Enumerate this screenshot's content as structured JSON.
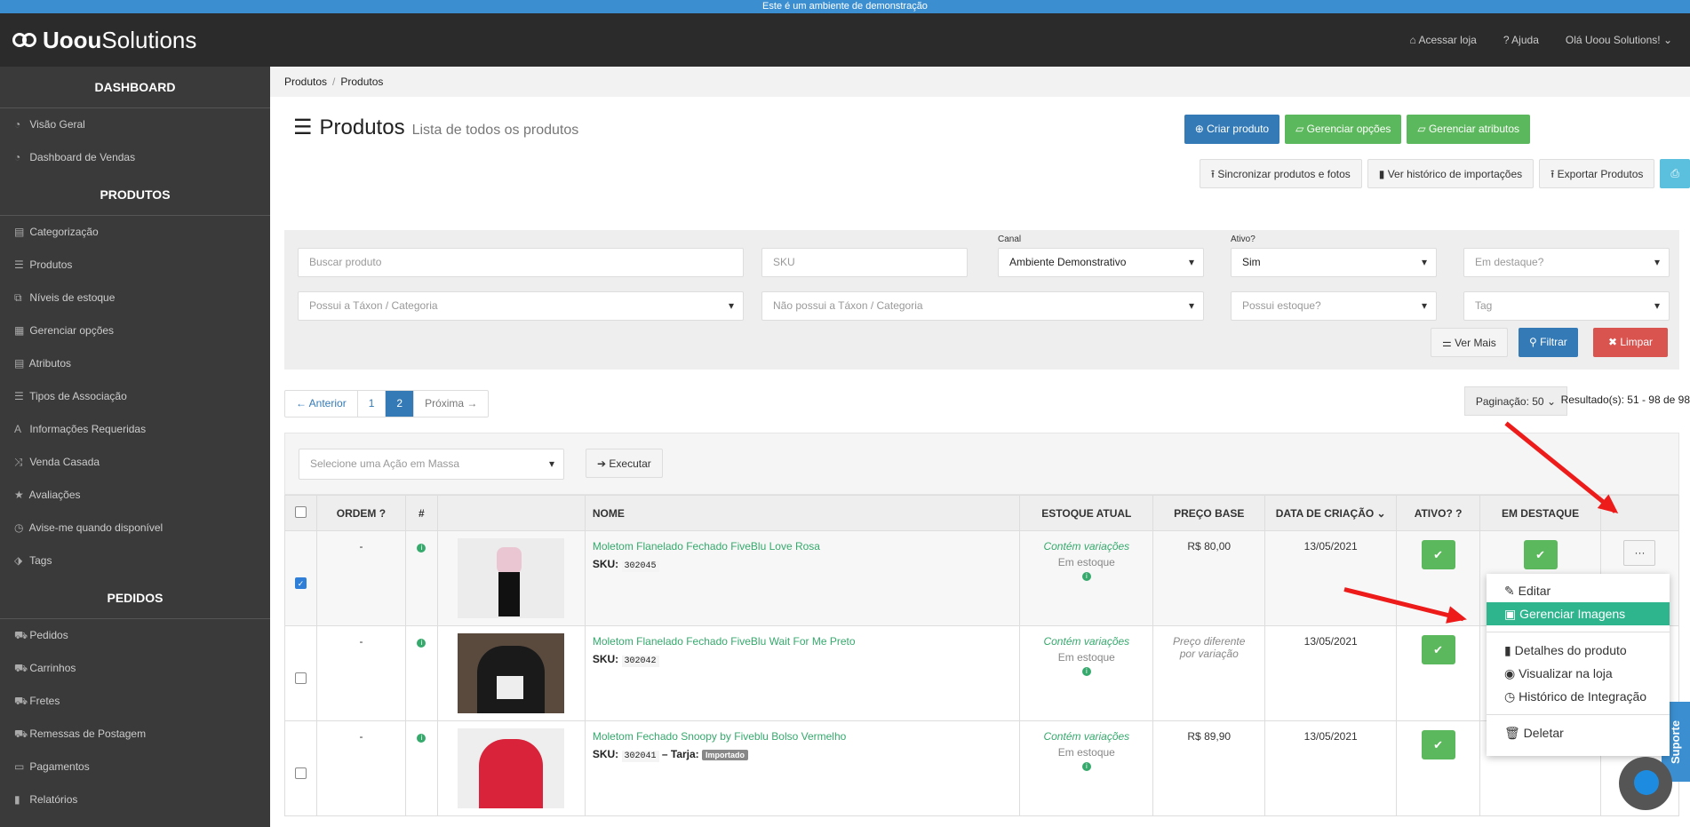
{
  "banner": "Este é um ambiente de demonstração",
  "brand": {
    "bold": "Uoou",
    "rest": "Solutions"
  },
  "topnav": {
    "store": "Acessar loja",
    "help": "Ajuda",
    "user": "Olá Uoou Solutions!"
  },
  "sidebar": {
    "dashboard": "DASHBOARD",
    "dash_items": [
      "Visão Geral",
      "Dashboard de Vendas"
    ],
    "produtos": "PRODUTOS",
    "prod_items": [
      "Categorização",
      "Produtos",
      "Níveis de estoque",
      "Gerenciar opções",
      "Atributos",
      "Tipos de Associação",
      "Informações Requeridas",
      "Venda Casada",
      "Avaliações",
      "Avise-me quando disponível",
      "Tags"
    ],
    "pedidos": "PEDIDOS",
    "ped_items": [
      "Pedidos",
      "Carrinhos",
      "Fretes",
      "Remessas de Postagem",
      "Pagamentos",
      "Relatórios"
    ]
  },
  "breadcrumb": [
    "Produtos",
    "Produtos"
  ],
  "page": {
    "title": "Produtos",
    "subtitle": "Lista de todos os produtos"
  },
  "actions": {
    "create": "Criar produto",
    "options": "Gerenciar opções",
    "attributes": "Gerenciar atributos",
    "sync": "Sincronizar produtos e fotos",
    "history": "Ver histórico de importações",
    "export": "Exportar Produtos"
  },
  "filters": {
    "search_ph": "Buscar produto",
    "sku_ph": "SKU",
    "canal_label": "Canal",
    "canal": "Ambiente Demonstrativo",
    "ativo_label": "Ativo?",
    "ativo": "Sim",
    "destaque_ph": "Em destaque?",
    "taxon_ph": "Possui a Táxon / Categoria",
    "no_taxon_ph": "Não possui a Táxon / Categoria",
    "stock_ph": "Possui estoque?",
    "tag_ph": "Tag",
    "more": "Ver Mais",
    "filter": "Filtrar",
    "clear": "Limpar"
  },
  "pager": {
    "prev": "← Anterior",
    "p1": "1",
    "p2": "2",
    "next": "Próxima →"
  },
  "paging": "Paginação: 50",
  "results": "Resultado(s): 51 - 98 de 98",
  "bulk": {
    "placeholder": "Selecione uma Ação em Massa",
    "execute": "Executar"
  },
  "columns": {
    "order": "ORDEM",
    "num": "#",
    "name": "NOME",
    "stock": "ESTOQUE ATUAL",
    "price": "PREÇO BASE",
    "date": "DATA DE CRIAÇÃO",
    "active": "ATIVO?",
    "featured": "EM DESTAQUE"
  },
  "rows": [
    {
      "order": "-",
      "name": "Moletom Flanelado Fechado FiveBlu Love Rosa",
      "sku": "302045",
      "tarja": "",
      "stock1": "Contém variações",
      "stock2": "Em estoque",
      "price": "R$ 80,00",
      "date": "13/05/2021"
    },
    {
      "order": "-",
      "name": "Moletom Flanelado Fechado FiveBlu Wait For Me Preto",
      "sku": "302042",
      "tarja": "",
      "stock1": "Contém variações",
      "stock2": "Em estoque",
      "price": "Preço diferente por variação",
      "date": "13/05/2021"
    },
    {
      "order": "-",
      "name": "Moletom Fechado Snoopy by Fiveblu Bolso Vermelho",
      "sku": "302041",
      "tarja": "Importado",
      "stock1": "Contém variações",
      "stock2": "Em estoque",
      "price": "R$ 89,90",
      "date": "13/05/2021"
    }
  ],
  "sku_label": "SKU:",
  "tarja_label": "– Tarja:",
  "menu": {
    "edit": "Editar",
    "images": "Gerenciar Imagens",
    "details": "Detalhes do produto",
    "view": "Visualizar na loja",
    "history": "Histórico de Integração",
    "delete": "Deletar"
  },
  "support": "Suporte"
}
